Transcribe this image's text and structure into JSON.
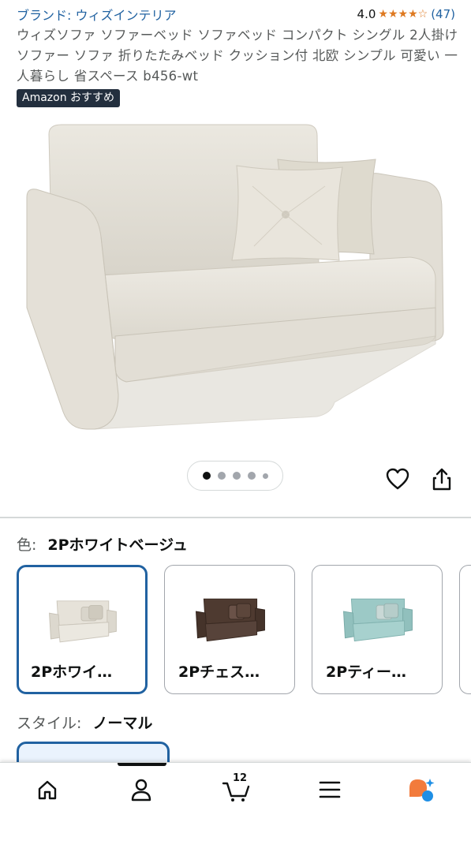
{
  "header": {
    "brand": "ブランド: ウィズインテリア",
    "rating_value": "4.0",
    "stars_filled": 4,
    "rating_count": "(47)"
  },
  "product": {
    "title": "ウィズソファ ソファーベッド ソファベッド コンパクト シングル 2人掛け ソファー ソファ 折りたたみベッド クッション付 北欧 シンプル 可愛い 一人暮らし 省スペース b456-wt",
    "badge": "Amazon おすすめ"
  },
  "gallery": {
    "dots_total": 5,
    "active_index": 0
  },
  "color": {
    "label": "色:",
    "selected": "2Pホワイトベージュ",
    "options": [
      {
        "label": "2Pホワイ…",
        "color": "#e6e2d9"
      },
      {
        "label": "2Pチェス…",
        "color": "#4e3a30"
      },
      {
        "label": "2Pティー…",
        "color": "#9cc9c6"
      }
    ]
  },
  "style": {
    "label": "スタイル:",
    "selected": "ノーマル"
  },
  "bottom_nav": {
    "cart_count": "12",
    "items": [
      "home-icon",
      "account-icon",
      "cart-icon",
      "menu-icon",
      "rufus-icon"
    ]
  },
  "colors": {
    "link": "#2162a1",
    "star": "#de7921",
    "badge_bg": "#232f3e",
    "selected_border": "#2162a1"
  }
}
